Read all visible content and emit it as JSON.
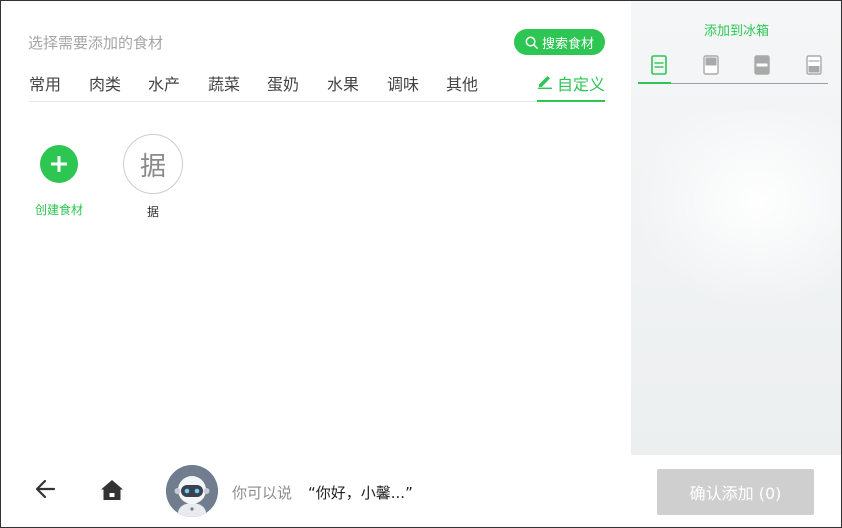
{
  "header": {
    "title": "选择需要添加的食材",
    "search_label": "搜索食材"
  },
  "tabs": [
    "常用",
    "肉类",
    "水产",
    "蔬菜",
    "蛋奶",
    "水果",
    "调味",
    "其他"
  ],
  "custom_tab": {
    "label": "自定义",
    "icon": "pencil-icon",
    "active": true
  },
  "items": {
    "create_label": "创建食材",
    "custom_item": {
      "glyph": "据",
      "label": "据"
    }
  },
  "right_panel": {
    "title": "添加到冰箱",
    "fridge_tabs": [
      "fridge-full-icon",
      "fridge-top-icon",
      "fridge-middle-icon",
      "fridge-bottom-icon"
    ],
    "active_tab": 0
  },
  "bottom_bar": {
    "hint": "你可以说",
    "quote": "“你好，小馨...”",
    "confirm_label": "确认添加 (0)"
  },
  "colors": {
    "accent": "#2dc653",
    "disabled": "#cfcfcf"
  }
}
